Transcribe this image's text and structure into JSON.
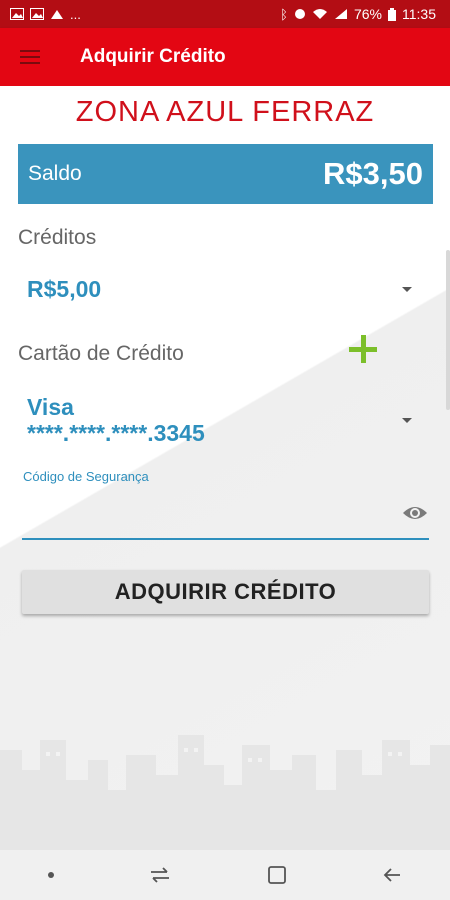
{
  "status_bar": {
    "left_icons": [
      "image-icon",
      "image-icon",
      "notification-icon"
    ],
    "overflow": "...",
    "battery": "76%",
    "time": "11:35"
  },
  "app_bar": {
    "title": "Adquirir Crédito"
  },
  "zone_name": "ZONA AZUL FERRAZ",
  "saldo": {
    "label": "Saldo",
    "value": "R$3,50"
  },
  "creditos": {
    "label": "Créditos",
    "selected": "R$5,00"
  },
  "cartao": {
    "label": "Cartão de Crédito",
    "brand": "Visa",
    "number": "****.****.****.3345"
  },
  "security_code": {
    "label": "Código de Segurança",
    "value": ""
  },
  "buy_button": {
    "label": "ADQUIRIR CRÉDITO"
  },
  "colors": {
    "primary": "#e30613",
    "accent": "#3a94bd",
    "add": "#7cbf2a"
  }
}
